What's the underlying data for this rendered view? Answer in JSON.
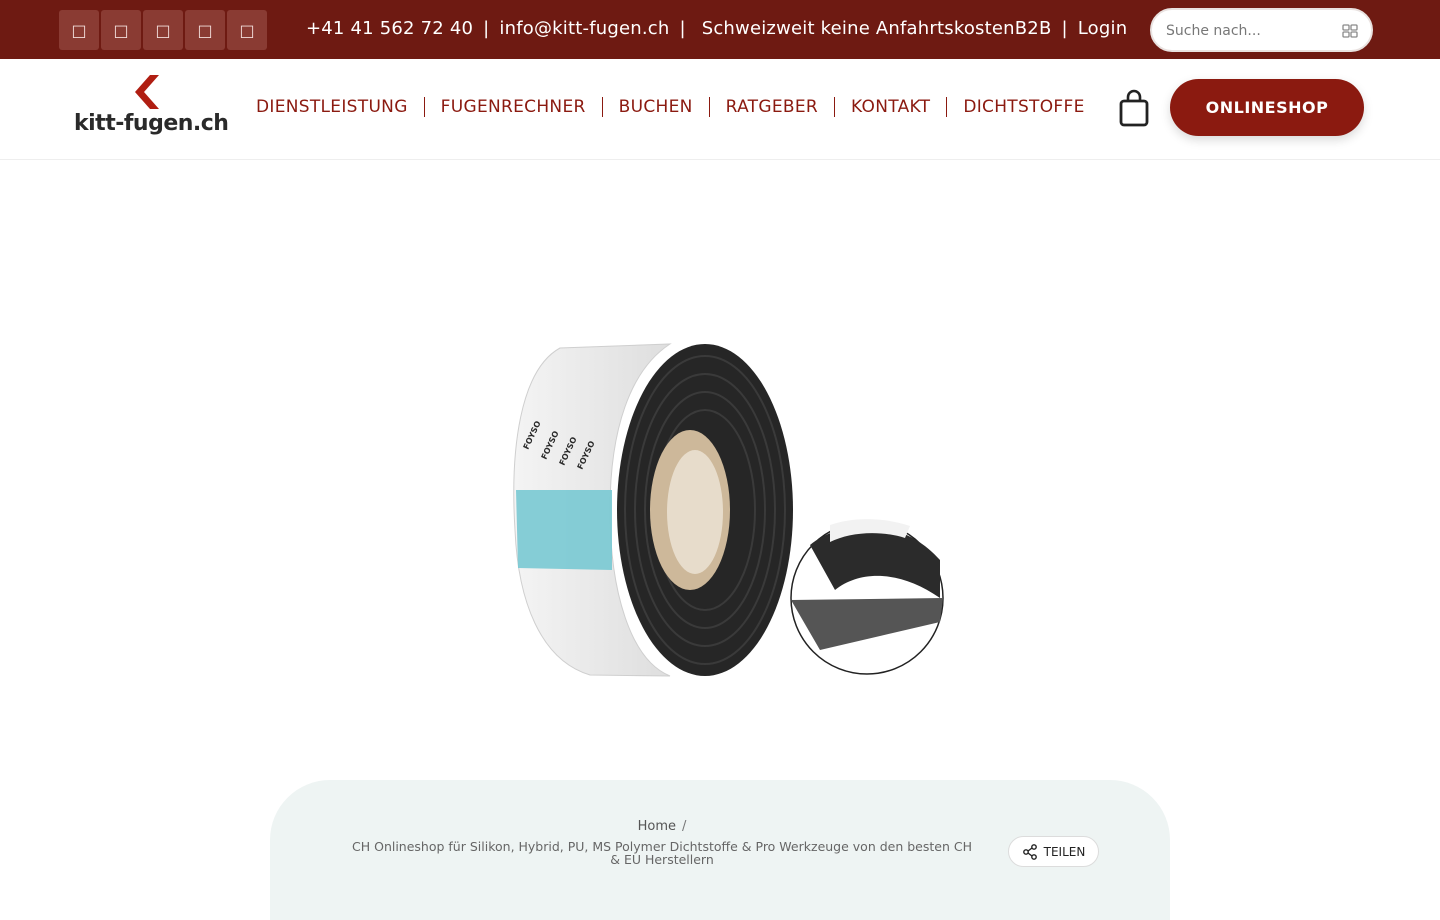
{
  "topbar": {
    "social_icons": [
      {
        "name": "facebook-icon",
        "glyph": "□"
      },
      {
        "name": "instagram-icon",
        "glyph": "□"
      },
      {
        "name": "linkedin-icon",
        "glyph": "□"
      },
      {
        "name": "youtube-icon",
        "glyph": "□"
      },
      {
        "name": "whatsapp-icon",
        "glyph": "□"
      }
    ],
    "phone": "+41 41 562 72 40",
    "email": "info@kitt-fugen.ch",
    "notice": "Schweizweit keine Anfahrtskosten",
    "b2b": "B2B",
    "separator": "|",
    "login": "Login",
    "search_placeholder": "Suche nach..."
  },
  "header": {
    "logo_text": "kitt-fugen.ch",
    "nav": [
      "DIENSTLEISTUNG",
      "FUGENRECHNER",
      "BUCHEN",
      "RATGEBER",
      "KONTAKT",
      "DICHTSTOFFE"
    ],
    "shop_button": "ONLINESHOP"
  },
  "breadcrumb": {
    "home": "Home",
    "slash": "/",
    "tagline": "CH Onlineshop für Silikon, Hybrid, PU, MS Polymer Dichtstoffe & Pro Werkzeuge von den besten CH & EU Herstellern",
    "share_label": "TEILEN"
  },
  "colors": {
    "brand": "#8b1a10",
    "topbar": "#6e1a12",
    "card": "#eef4f3"
  }
}
